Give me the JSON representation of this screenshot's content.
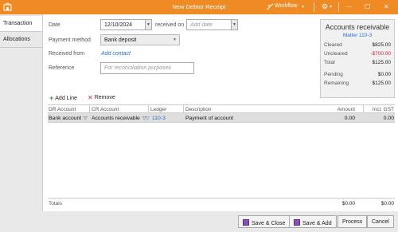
{
  "window": {
    "title": "New Debtor Receipt",
    "workflow_label": "Workflow",
    "workflow_chevron": "▾",
    "settings_glyph": "⚙",
    "minimize_glyph": "—",
    "maximize_glyph": "☐",
    "close_glyph": "✕"
  },
  "tabs": [
    "Transaction",
    "Allocations"
  ],
  "form": {
    "date_label": "Date",
    "date_value": "12/10/2024",
    "received_on_label": "received on",
    "received_on_placeholder": "Add date",
    "payment_method_label": "Payment method",
    "payment_method_value": "Bank deposit",
    "received_from_label": "Received from",
    "add_contact_link": "Add contact",
    "reference_label": "Reference",
    "reference_placeholder": "For reconciliation purposes"
  },
  "accounts_panel": {
    "heading": "Accounts receivable",
    "matter": "Matter 110-3",
    "rows": [
      {
        "label": "Cleared",
        "value": "$825.00"
      },
      {
        "label": "Uncleared",
        "value": "-$700.00"
      },
      {
        "label": "Total",
        "value": "$125.00"
      },
      {
        "label": "Pending",
        "value": "$0.00"
      },
      {
        "label": "Remaining",
        "value": "$125.00"
      }
    ]
  },
  "toolbar": {
    "add_line": "Add Line",
    "remove": "Remove"
  },
  "grid": {
    "columns": [
      "DR Account",
      "CR Account",
      "Ledger",
      "Description",
      "Amount",
      "Incl. GST"
    ],
    "rows": [
      {
        "dr_account": "Bank account",
        "cr_account": "Accounts receivable",
        "ledger": "110-3",
        "description": "Payment of account",
        "amount": "0.00",
        "incl_gst": "0.00"
      }
    ]
  },
  "totals": {
    "label": "Totals",
    "amount": "$0.00",
    "incl_gst": "$0.00"
  },
  "footer": {
    "save_close": "Save & Close",
    "save_add": "Save & Add",
    "process": "Process",
    "cancel": "Cancel"
  },
  "colors": {
    "accent": "#f08a24",
    "link": "#2a6fc9",
    "negative": "#dd2233",
    "add_icon": "#3a9a3a",
    "remove_icon": "#d23333"
  }
}
